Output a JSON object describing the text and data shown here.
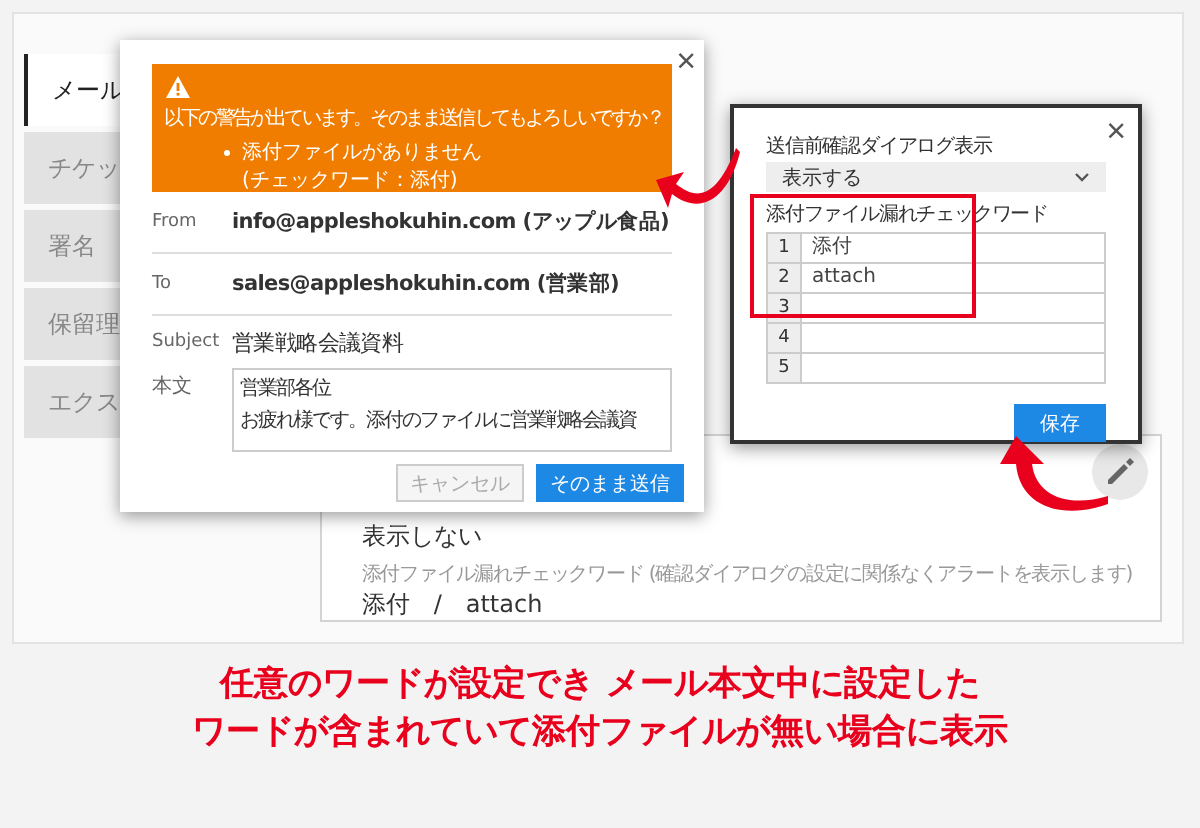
{
  "sidebar": {
    "items": [
      {
        "label": "メール",
        "selected": true
      },
      {
        "label": "チケッ",
        "selected": false
      },
      {
        "label": "署名",
        "selected": false
      },
      {
        "label": "保留理",
        "selected": false
      },
      {
        "label": "エクス",
        "selected": false
      }
    ]
  },
  "settings_card": {
    "value": "表示しない",
    "label": "添付ファイル漏れチェックワード (確認ダイアログの設定に関係なくアラートを表示します)",
    "words": "添付　/　attach"
  },
  "send_dialog": {
    "close": "×",
    "warning": {
      "title": "以下の警告が出ています。そのまま送信してもよろしいですか？",
      "items": [
        "添付ファイルがありません"
      ],
      "note": "(チェックワード：添付)"
    },
    "fields": [
      {
        "label": "From",
        "value": "info@appleshokuhin.com (アップル食品)"
      },
      {
        "label": "To",
        "value": "sales@appleshokuhin.com (営業部)"
      },
      {
        "label": "Subject",
        "value": "営業戦略会議資料"
      }
    ],
    "body": {
      "label": "本文",
      "lines": [
        "営業部各位",
        "お疲れ様です。添付のファイルに営業戦略会議資"
      ]
    },
    "buttons": [
      {
        "label": "キャンセル",
        "kind": "secondary"
      },
      {
        "label": "そのまま送信",
        "kind": "primary"
      }
    ]
  },
  "settings_dialog": {
    "close": "×",
    "display_label": "送信前確認ダイアログ表示",
    "display_value": "表示する",
    "words_label": "添付ファイル漏れチェックワード",
    "words": [
      {
        "index": "1",
        "value": "添付"
      },
      {
        "index": "2",
        "value": "attach"
      },
      {
        "index": "3"
      },
      {
        "index": "4"
      },
      {
        "index": "5"
      }
    ],
    "save": "保存"
  },
  "caption": [
    "任意のワードが設定でき メール本文中に設定した",
    "ワードが含まれていて添付ファイルが無い場合に表示"
  ]
}
